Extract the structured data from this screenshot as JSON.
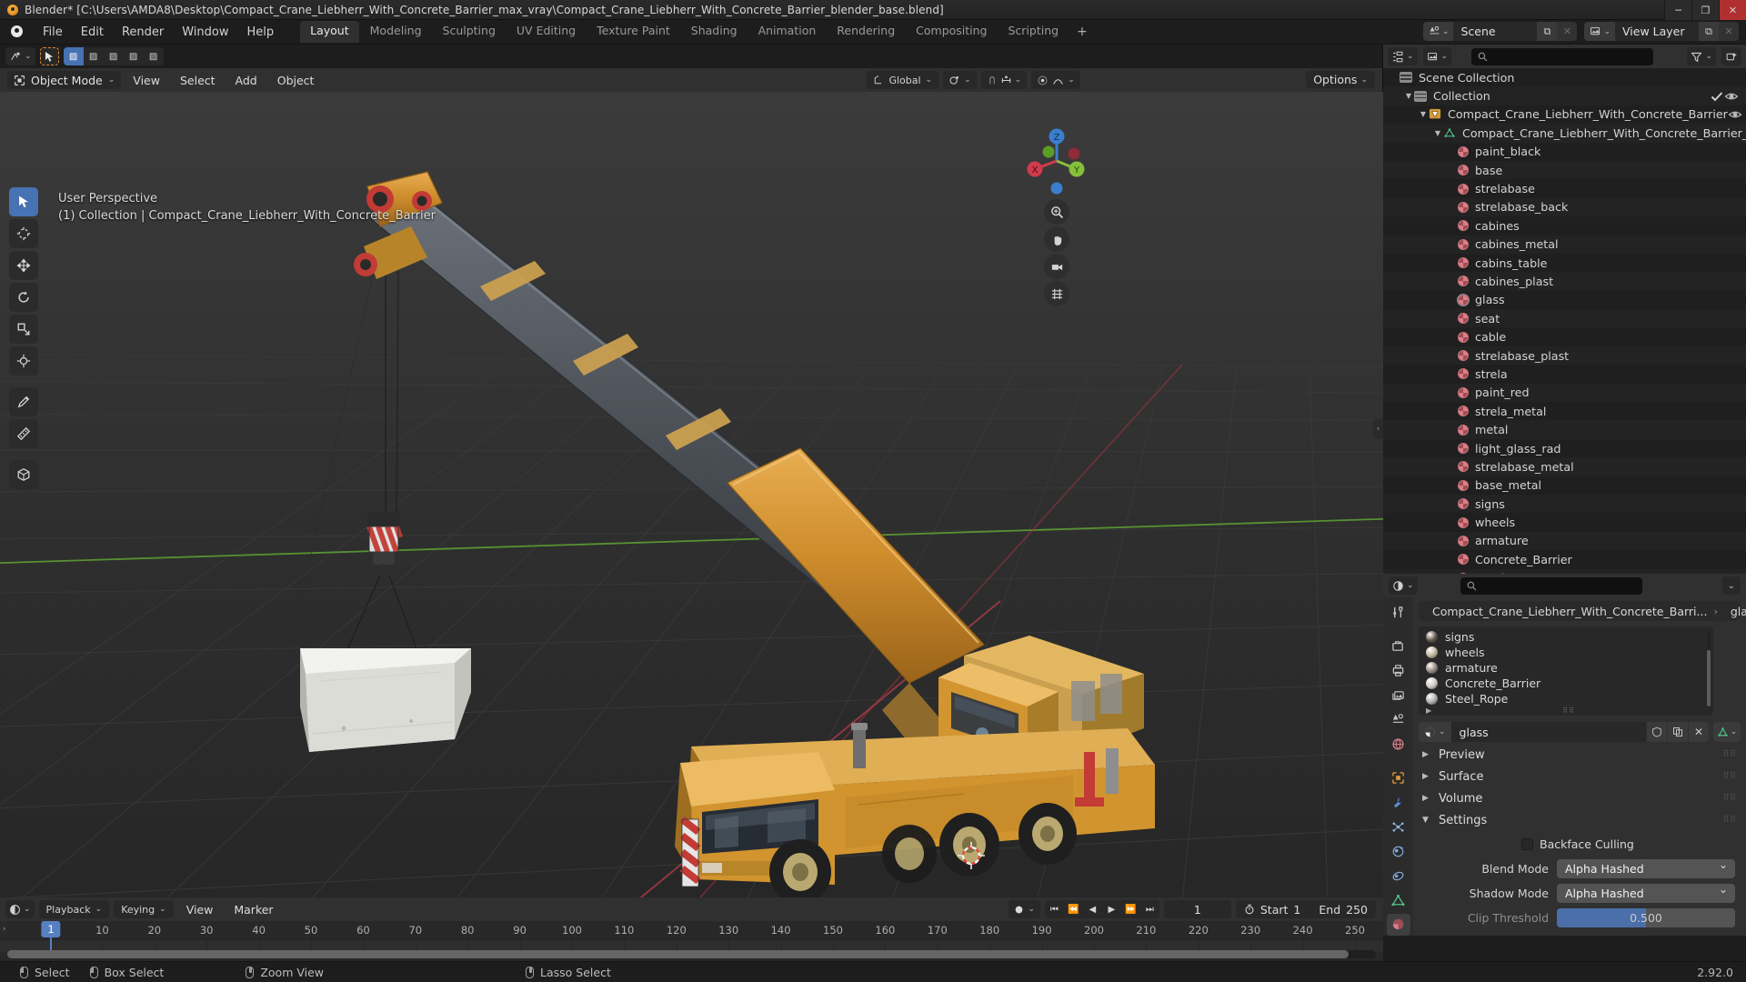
{
  "window": {
    "title": "Blender* [C:\\Users\\AMDA8\\Desktop\\Compact_Crane_Liebherr_With_Concrete_Barrier_max_vray\\Compact_Crane_Liebherr_With_Concrete_Barrier_blender_base.blend]",
    "minimize": "─",
    "maximize": "❐",
    "close": "✕"
  },
  "topbar": {
    "menus": [
      "File",
      "Edit",
      "Render",
      "Window",
      "Help"
    ],
    "workspaces": [
      "Layout",
      "Modeling",
      "Sculpting",
      "UV Editing",
      "Texture Paint",
      "Shading",
      "Animation",
      "Rendering",
      "Compositing",
      "Scripting"
    ],
    "active_workspace": "Layout",
    "add_workspace": "+",
    "scene_label": "Scene",
    "viewlayer_label": "View Layer",
    "copy_icon": "⧉",
    "x_icon": "✕"
  },
  "viewport": {
    "mode": "Object Mode",
    "menus": [
      "View",
      "Select",
      "Add",
      "Object"
    ],
    "orientation": "Global",
    "options_label": "Options",
    "overlay_line1": "User Perspective",
    "overlay_line2": "(1) Collection | Compact_Crane_Liebherr_With_Concrete_Barrier",
    "gizmo_axes": [
      "X",
      "Y",
      "Z"
    ],
    "tools": [
      {
        "name": "tweak-tool",
        "active": true
      },
      {
        "name": "cursor-tool",
        "active": false
      },
      {
        "name": "move-tool",
        "active": false
      },
      {
        "name": "rotate-tool",
        "active": false
      },
      {
        "name": "scale-tool",
        "active": false
      },
      {
        "name": "transform-tool",
        "active": false
      },
      {
        "name": "annotate-tool",
        "active": false
      },
      {
        "name": "measure-tool",
        "active": false
      },
      {
        "name": "add-cube-tool",
        "active": false
      }
    ]
  },
  "outliner": {
    "search_placeholder": "",
    "rows": [
      {
        "label": "Scene Collection",
        "indent": 0,
        "icon": "collection-icon",
        "disclosure": "",
        "selected": false
      },
      {
        "label": "Collection",
        "indent": 1,
        "icon": "collection-icon",
        "disclosure": "▼",
        "selected": false,
        "checkbox": true,
        "eye": true
      },
      {
        "label": "Compact_Crane_Liebherr_With_Concrete_Barrier",
        "indent": 2,
        "icon": "object-icon",
        "disclosure": "▼",
        "selected": false,
        "eye": true
      },
      {
        "label": "Compact_Crane_Liebherr_With_Concrete_Barrier_obj",
        "indent": 3,
        "icon": "mesh-icon",
        "disclosure": "▼",
        "selected": false
      },
      {
        "label": "paint_black",
        "indent": 4,
        "icon": "material-icon",
        "disclosure": "",
        "selected": false
      },
      {
        "label": "base",
        "indent": 4,
        "icon": "material-icon",
        "disclosure": "",
        "selected": false
      },
      {
        "label": "strelabase",
        "indent": 4,
        "icon": "material-icon",
        "disclosure": "",
        "selected": false
      },
      {
        "label": "strelabase_back",
        "indent": 4,
        "icon": "material-icon",
        "disclosure": "",
        "selected": false
      },
      {
        "label": "cabines",
        "indent": 4,
        "icon": "material-icon",
        "disclosure": "",
        "selected": false
      },
      {
        "label": "cabines_metal",
        "indent": 4,
        "icon": "material-icon",
        "disclosure": "",
        "selected": false
      },
      {
        "label": "cabins_table",
        "indent": 4,
        "icon": "material-icon",
        "disclosure": "",
        "selected": false
      },
      {
        "label": "cabines_plast",
        "indent": 4,
        "icon": "material-icon",
        "disclosure": "",
        "selected": false
      },
      {
        "label": "glass",
        "indent": 4,
        "icon": "material-icon",
        "disclosure": "",
        "selected": true
      },
      {
        "label": "seat",
        "indent": 4,
        "icon": "material-icon",
        "disclosure": "",
        "selected": false
      },
      {
        "label": "cable",
        "indent": 4,
        "icon": "material-icon",
        "disclosure": "",
        "selected": false
      },
      {
        "label": "strelabase_plast",
        "indent": 4,
        "icon": "material-icon",
        "disclosure": "",
        "selected": false
      },
      {
        "label": "strela",
        "indent": 4,
        "icon": "material-icon",
        "disclosure": "",
        "selected": false
      },
      {
        "label": "paint_red",
        "indent": 4,
        "icon": "material-icon",
        "disclosure": "",
        "selected": false
      },
      {
        "label": "strela_metal",
        "indent": 4,
        "icon": "material-icon",
        "disclosure": "",
        "selected": false
      },
      {
        "label": "metal",
        "indent": 4,
        "icon": "material-icon",
        "disclosure": "",
        "selected": false
      },
      {
        "label": "light_glass_rad",
        "indent": 4,
        "icon": "material-icon",
        "disclosure": "",
        "selected": false
      },
      {
        "label": "strelabase_metal",
        "indent": 4,
        "icon": "material-icon",
        "disclosure": "",
        "selected": false
      },
      {
        "label": "base_metal",
        "indent": 4,
        "icon": "material-icon",
        "disclosure": "",
        "selected": false
      },
      {
        "label": "signs",
        "indent": 4,
        "icon": "material-icon",
        "disclosure": "",
        "selected": false
      },
      {
        "label": "wheels",
        "indent": 4,
        "icon": "material-icon",
        "disclosure": "",
        "selected": false
      },
      {
        "label": "armature",
        "indent": 4,
        "icon": "material-icon",
        "disclosure": "",
        "selected": false
      },
      {
        "label": "Concrete_Barrier",
        "indent": 4,
        "icon": "material-icon",
        "disclosure": "",
        "selected": false
      },
      {
        "label": "Steel_Rope",
        "indent": 4,
        "icon": "material-icon",
        "disclosure": "",
        "selected": false
      }
    ]
  },
  "properties": {
    "search_placeholder": "",
    "breadcrumb_object": "Compact_Crane_Liebherr_With_Concrete_Barri...",
    "breadcrumb_separator": "›",
    "breadcrumb_material": "glass",
    "material_slots": [
      {
        "label": "signs",
        "color": "#5c5045"
      },
      {
        "label": "wheels",
        "color": "#b9ae93"
      },
      {
        "label": "armature",
        "color": "#8d8377"
      },
      {
        "label": "Concrete_Barrier",
        "color": "#c8c4bc"
      },
      {
        "label": "Steel_Rope",
        "color": "#a8a8a8"
      }
    ],
    "slot_buttons": [
      "+",
      "−",
      "⌄",
      "▲",
      "▼"
    ],
    "material_name": "glass",
    "material_field_buttons": [
      "shield",
      "copy",
      "✕"
    ],
    "panels": [
      {
        "label": "Preview",
        "open": false
      },
      {
        "label": "Surface",
        "open": false
      },
      {
        "label": "Volume",
        "open": false
      },
      {
        "label": "Settings",
        "open": true
      }
    ],
    "settings": {
      "backface_culling_label": "Backface Culling",
      "backface_culling_checked": false,
      "blend_mode_label": "Blend Mode",
      "blend_mode_value": "Alpha Hashed",
      "shadow_mode_label": "Shadow Mode",
      "shadow_mode_value": "Alpha Hashed",
      "clip_threshold_label": "Clip Threshold",
      "clip_threshold_value": "0.500",
      "clip_threshold_fill_pct": 50
    }
  },
  "timeline": {
    "menus": [
      "Playback",
      "Keying",
      "View",
      "Marker"
    ],
    "playback_label": "Playback",
    "keying_label": "Keying",
    "view_label": "View",
    "marker_label": "Marker",
    "current_frame": "1",
    "start_label": "Start",
    "start_value": "1",
    "end_label": "End",
    "end_value": "250",
    "ticks": [
      "1",
      "10",
      "20",
      "30",
      "40",
      "50",
      "60",
      "70",
      "80",
      "90",
      "100",
      "110",
      "120",
      "130",
      "140",
      "150",
      "160",
      "170",
      "180",
      "190",
      "200",
      "210",
      "220",
      "230",
      "240",
      "250"
    ],
    "playhead_frame": "1"
  },
  "statusbar": {
    "items": [
      {
        "label": "Select",
        "mouse": "left"
      },
      {
        "label": "Box Select",
        "mouse": "left-drag"
      },
      {
        "label": "Zoom View",
        "mouse": "middle"
      },
      {
        "label": "Lasso Select",
        "mouse": "middle2"
      }
    ],
    "version": "2.92.0"
  },
  "colors": {
    "accent_blue": "#4772b3",
    "axis_x": "#cf3b4b",
    "axis_y": "#86c03a",
    "axis_z": "#3b7ecf",
    "material_pink": "#e07c86",
    "crane_orange": "#d4972f"
  }
}
